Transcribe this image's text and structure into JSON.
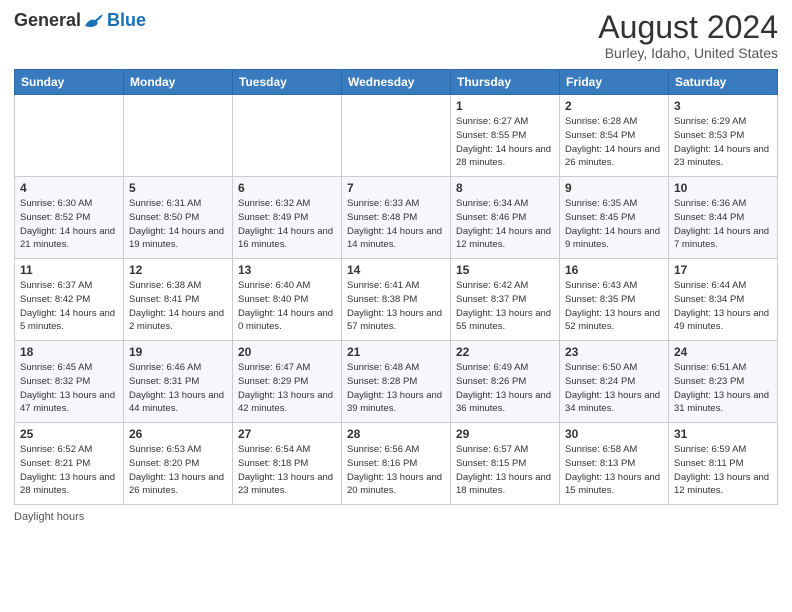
{
  "header": {
    "logo_general": "General",
    "logo_blue": "Blue",
    "month_year": "August 2024",
    "location": "Burley, Idaho, United States"
  },
  "days_of_week": [
    "Sunday",
    "Monday",
    "Tuesday",
    "Wednesday",
    "Thursday",
    "Friday",
    "Saturday"
  ],
  "weeks": [
    [
      {
        "day": "",
        "info": ""
      },
      {
        "day": "",
        "info": ""
      },
      {
        "day": "",
        "info": ""
      },
      {
        "day": "",
        "info": ""
      },
      {
        "day": "1",
        "info": "Sunrise: 6:27 AM\nSunset: 8:55 PM\nDaylight: 14 hours and 28 minutes."
      },
      {
        "day": "2",
        "info": "Sunrise: 6:28 AM\nSunset: 8:54 PM\nDaylight: 14 hours and 26 minutes."
      },
      {
        "day": "3",
        "info": "Sunrise: 6:29 AM\nSunset: 8:53 PM\nDaylight: 14 hours and 23 minutes."
      }
    ],
    [
      {
        "day": "4",
        "info": "Sunrise: 6:30 AM\nSunset: 8:52 PM\nDaylight: 14 hours and 21 minutes."
      },
      {
        "day": "5",
        "info": "Sunrise: 6:31 AM\nSunset: 8:50 PM\nDaylight: 14 hours and 19 minutes."
      },
      {
        "day": "6",
        "info": "Sunrise: 6:32 AM\nSunset: 8:49 PM\nDaylight: 14 hours and 16 minutes."
      },
      {
        "day": "7",
        "info": "Sunrise: 6:33 AM\nSunset: 8:48 PM\nDaylight: 14 hours and 14 minutes."
      },
      {
        "day": "8",
        "info": "Sunrise: 6:34 AM\nSunset: 8:46 PM\nDaylight: 14 hours and 12 minutes."
      },
      {
        "day": "9",
        "info": "Sunrise: 6:35 AM\nSunset: 8:45 PM\nDaylight: 14 hours and 9 minutes."
      },
      {
        "day": "10",
        "info": "Sunrise: 6:36 AM\nSunset: 8:44 PM\nDaylight: 14 hours and 7 minutes."
      }
    ],
    [
      {
        "day": "11",
        "info": "Sunrise: 6:37 AM\nSunset: 8:42 PM\nDaylight: 14 hours and 5 minutes."
      },
      {
        "day": "12",
        "info": "Sunrise: 6:38 AM\nSunset: 8:41 PM\nDaylight: 14 hours and 2 minutes."
      },
      {
        "day": "13",
        "info": "Sunrise: 6:40 AM\nSunset: 8:40 PM\nDaylight: 14 hours and 0 minutes."
      },
      {
        "day": "14",
        "info": "Sunrise: 6:41 AM\nSunset: 8:38 PM\nDaylight: 13 hours and 57 minutes."
      },
      {
        "day": "15",
        "info": "Sunrise: 6:42 AM\nSunset: 8:37 PM\nDaylight: 13 hours and 55 minutes."
      },
      {
        "day": "16",
        "info": "Sunrise: 6:43 AM\nSunset: 8:35 PM\nDaylight: 13 hours and 52 minutes."
      },
      {
        "day": "17",
        "info": "Sunrise: 6:44 AM\nSunset: 8:34 PM\nDaylight: 13 hours and 49 minutes."
      }
    ],
    [
      {
        "day": "18",
        "info": "Sunrise: 6:45 AM\nSunset: 8:32 PM\nDaylight: 13 hours and 47 minutes."
      },
      {
        "day": "19",
        "info": "Sunrise: 6:46 AM\nSunset: 8:31 PM\nDaylight: 13 hours and 44 minutes."
      },
      {
        "day": "20",
        "info": "Sunrise: 6:47 AM\nSunset: 8:29 PM\nDaylight: 13 hours and 42 minutes."
      },
      {
        "day": "21",
        "info": "Sunrise: 6:48 AM\nSunset: 8:28 PM\nDaylight: 13 hours and 39 minutes."
      },
      {
        "day": "22",
        "info": "Sunrise: 6:49 AM\nSunset: 8:26 PM\nDaylight: 13 hours and 36 minutes."
      },
      {
        "day": "23",
        "info": "Sunrise: 6:50 AM\nSunset: 8:24 PM\nDaylight: 13 hours and 34 minutes."
      },
      {
        "day": "24",
        "info": "Sunrise: 6:51 AM\nSunset: 8:23 PM\nDaylight: 13 hours and 31 minutes."
      }
    ],
    [
      {
        "day": "25",
        "info": "Sunrise: 6:52 AM\nSunset: 8:21 PM\nDaylight: 13 hours and 28 minutes."
      },
      {
        "day": "26",
        "info": "Sunrise: 6:53 AM\nSunset: 8:20 PM\nDaylight: 13 hours and 26 minutes."
      },
      {
        "day": "27",
        "info": "Sunrise: 6:54 AM\nSunset: 8:18 PM\nDaylight: 13 hours and 23 minutes."
      },
      {
        "day": "28",
        "info": "Sunrise: 6:56 AM\nSunset: 8:16 PM\nDaylight: 13 hours and 20 minutes."
      },
      {
        "day": "29",
        "info": "Sunrise: 6:57 AM\nSunset: 8:15 PM\nDaylight: 13 hours and 18 minutes."
      },
      {
        "day": "30",
        "info": "Sunrise: 6:58 AM\nSunset: 8:13 PM\nDaylight: 13 hours and 15 minutes."
      },
      {
        "day": "31",
        "info": "Sunrise: 6:59 AM\nSunset: 8:11 PM\nDaylight: 13 hours and 12 minutes."
      }
    ]
  ],
  "footer": {
    "note": "Daylight hours"
  }
}
